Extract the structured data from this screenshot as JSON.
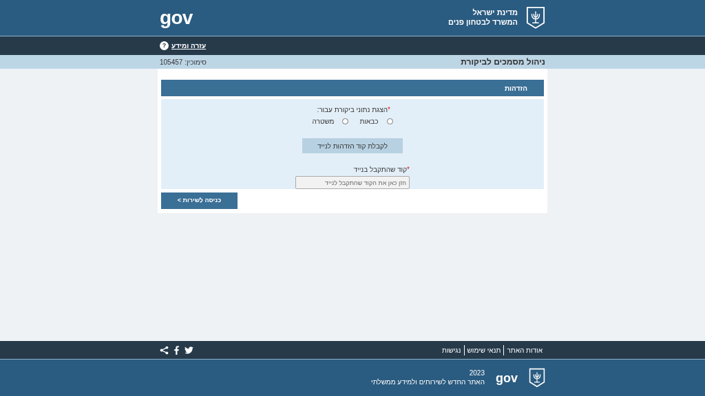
{
  "header": {
    "state": "מדינת ישראל",
    "ministry": "המשרד לבטחון פנים",
    "logo_text": "gov"
  },
  "nav": {
    "help_link": "עזרה ומידע",
    "help_icon": "?"
  },
  "title_bar": {
    "title": "ניהול מסמכים לביקורת",
    "reference": "סימוכין: 105457"
  },
  "form": {
    "section_title": "הזדהות",
    "radio_label": "הצגת נתוני ביקורת עבור:",
    "required_mark": "*",
    "radios": [
      {
        "label": "כבאות",
        "selected": false
      },
      {
        "label": "משטרה",
        "selected": false
      }
    ],
    "code_button": "לקבלת קוד הזדהות לנייד",
    "code_label": "קוד שהתקבל בנייד",
    "code_placeholder": "הזן כאן את הקוד שהתקבל לנייד",
    "submit_button": "כניסה לשירות >"
  },
  "footer": {
    "links": [
      "אודות האתר",
      "תנאי שימוש",
      "נגישות"
    ],
    "year": "2023",
    "tagline": "האתר החדש לשירותים ולמידע ממשלתי",
    "logo_text": "gov"
  }
}
